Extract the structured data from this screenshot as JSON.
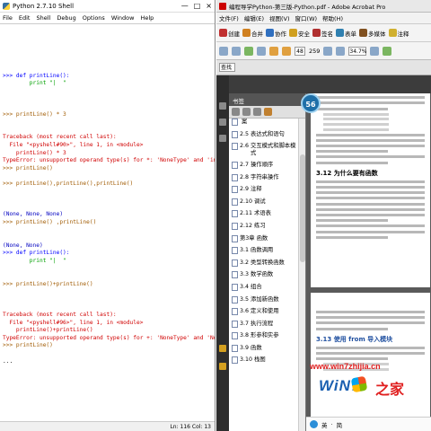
{
  "shell": {
    "title": "Python 2.7.10 Shell",
    "window_controls": [
      "—",
      "□",
      "×"
    ],
    "menu": [
      "File",
      "Edit",
      "Shell",
      "Debug",
      "Options",
      "Window",
      "Help"
    ],
    "lines": [
      {
        "t": "",
        "c": ""
      },
      {
        "t": "",
        "c": ""
      },
      {
        "t": "",
        "c": ""
      },
      {
        "t": "",
        "c": ""
      },
      {
        "t": "",
        "c": ""
      },
      {
        "t": "",
        "c": ""
      },
      {
        "t": ">>> def printLine():",
        "c": "def"
      },
      {
        "t": "        print \"|  \"",
        "c": "str"
      },
      {
        "t": "",
        "c": ""
      },
      {
        "t": "",
        "c": ""
      },
      {
        "t": "",
        "c": ""
      },
      {
        "t": ">>> printLine() * 3",
        "c": "prompt"
      },
      {
        "t": "",
        "c": ""
      },
      {
        "t": "",
        "c": ""
      },
      {
        "t": "Traceback (most recent call last):",
        "c": "err"
      },
      {
        "t": "  File \"<pyshell#90>\", line 1, in <module>",
        "c": "err"
      },
      {
        "t": "    printLine() * 3",
        "c": "err"
      },
      {
        "t": "TypeError: unsupported operand type(s) for *: 'NoneType' and 'int'",
        "c": "err"
      },
      {
        "t": ">>> printLine()",
        "c": "prompt"
      },
      {
        "t": "",
        "c": ""
      },
      {
        "t": ">>> printLine(),printLine(),printLine()",
        "c": "prompt"
      },
      {
        "t": "",
        "c": ""
      },
      {
        "t": "",
        "c": ""
      },
      {
        "t": "",
        "c": ""
      },
      {
        "t": "(None, None, None)",
        "c": "out"
      },
      {
        "t": ">>> printLine() ,printLine()",
        "c": "prompt"
      },
      {
        "t": "",
        "c": ""
      },
      {
        "t": "",
        "c": ""
      },
      {
        "t": "(None, None)",
        "c": "out"
      },
      {
        "t": ">>> def printLine():",
        "c": "def"
      },
      {
        "t": "        print \"|  \"",
        "c": "str"
      },
      {
        "t": "",
        "c": ""
      },
      {
        "t": "",
        "c": ""
      },
      {
        "t": ">>> printLine()+printLine()",
        "c": "prompt"
      },
      {
        "t": "",
        "c": ""
      },
      {
        "t": "",
        "c": ""
      },
      {
        "t": "",
        "c": ""
      },
      {
        "t": "Traceback (most recent call last):",
        "c": "err"
      },
      {
        "t": "  File \"<pyshell#96>\", line 1, in <module>",
        "c": "err"
      },
      {
        "t": "    printLine()+printLine()",
        "c": "err"
      },
      {
        "t": "TypeError: unsupported operand type(s) for +: 'NoneType' and 'NoneType'",
        "c": "err"
      },
      {
        "t": ">>> printLine()",
        "c": "prompt"
      },
      {
        "t": "",
        "c": ""
      },
      {
        "t": "...",
        "c": ""
      }
    ],
    "status": "Ln: 116 Col: 13"
  },
  "acrobat": {
    "title": "编程导学Python-第三版-Python.pdf - Adobe Acrobat Pro",
    "menu": [
      "文件(F)",
      "编辑(E)",
      "视图(V)",
      "窗口(W)",
      "帮助(H)"
    ],
    "toolbar1": [
      {
        "label": "创建",
        "icon": "create-icon",
        "color": "#c03030"
      },
      {
        "label": "合并",
        "icon": "combine-icon",
        "color": "#d08020"
      },
      {
        "label": "协作",
        "icon": "collaborate-icon",
        "color": "#3070c0"
      },
      {
        "label": "安全",
        "icon": "lock-icon",
        "color": "#d0a020"
      },
      {
        "label": "签名",
        "icon": "sign-icon",
        "color": "#b03030"
      },
      {
        "label": "表单",
        "icon": "form-icon",
        "color": "#3080b0"
      },
      {
        "label": "多媒体",
        "icon": "media-icon",
        "color": "#805020"
      },
      {
        "label": "注释",
        "icon": "comment-icon",
        "color": "#d0b030"
      }
    ],
    "page_current": "48",
    "page_total": "259",
    "zoom": "34.7%",
    "find_label": "查找",
    "bookmarks_header": "书签",
    "zoom_badge": "56",
    "bookmarks": [
      {
        "num": "",
        "title": "案"
      },
      {
        "num": "2.5",
        "title": "表达式和语句"
      },
      {
        "num": "2.6",
        "title": "交互模式和脚本模式"
      },
      {
        "num": "2.7",
        "title": "操作顺序"
      },
      {
        "num": "2.8",
        "title": "字符串操作"
      },
      {
        "num": "2.9",
        "title": "注释"
      },
      {
        "num": "2.10",
        "title": "调试"
      },
      {
        "num": "2.11",
        "title": "术语表"
      },
      {
        "num": "2.12",
        "title": "练习"
      },
      {
        "num": "第3章",
        "title": "函数"
      },
      {
        "num": "3.1",
        "title": "函数调用"
      },
      {
        "num": "3.2",
        "title": "类型转换函数"
      },
      {
        "num": "3.3",
        "title": "数学函数"
      },
      {
        "num": "3.4",
        "title": "组合"
      },
      {
        "num": "3.5",
        "title": "添加新函数"
      },
      {
        "num": "3.6",
        "title": "定义和使用"
      },
      {
        "num": "3.7",
        "title": "执行流程"
      },
      {
        "num": "3.8",
        "title": "形参和实参"
      },
      {
        "num": "3.9",
        "title": "函数"
      },
      {
        "num": "3.10",
        "title": "栈图"
      }
    ],
    "page1_heading": "3.12  为什么要有函数",
    "page2_heading": "3.13  使用 from 导入模块"
  },
  "watermark": {
    "url": "www.win7zhijia.cn",
    "logo": "WiN7",
    "logo_cn": "之家"
  },
  "taskbar": {
    "items": [
      "英",
      "·",
      "简"
    ]
  }
}
